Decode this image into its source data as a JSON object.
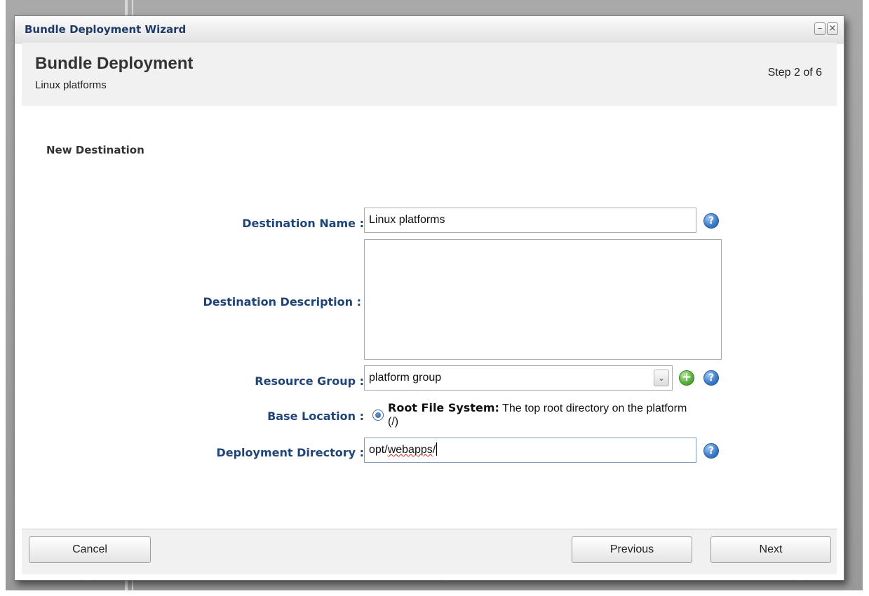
{
  "window": {
    "title": "Bundle Deployment Wizard",
    "minimize_glyph": "–",
    "close_glyph": "×"
  },
  "header": {
    "title": "Bundle Deployment",
    "subtitle": "Linux platforms",
    "step": "Step 2 of 6"
  },
  "section": {
    "title": "New Destination"
  },
  "form": {
    "destination_name": {
      "label": "Destination Name :",
      "value": "Linux platforms"
    },
    "destination_description": {
      "label": "Destination Description :",
      "value": ""
    },
    "resource_group": {
      "label": "Resource Group :",
      "value": "platform group"
    },
    "base_location": {
      "label": "Base Location :",
      "option_bold": "Root File System:",
      "option_text": " The top root directory on the platform (/)"
    },
    "deployment_directory": {
      "label": "Deployment Directory :",
      "value_prefix": "opt/",
      "value_misspelled": "webapps",
      "value_suffix": "/"
    }
  },
  "icons": {
    "help_glyph": "?",
    "add_glyph": "+",
    "dropdown_glyph": "⌄"
  },
  "footer": {
    "cancel_label": "Cancel",
    "previous_label": "Previous",
    "next_label": "Next"
  },
  "colors": {
    "label_blue": "#1e4478",
    "title_blue": "#1f3a66",
    "help_blue": "#3a79c7",
    "add_green": "#56ad3a"
  }
}
